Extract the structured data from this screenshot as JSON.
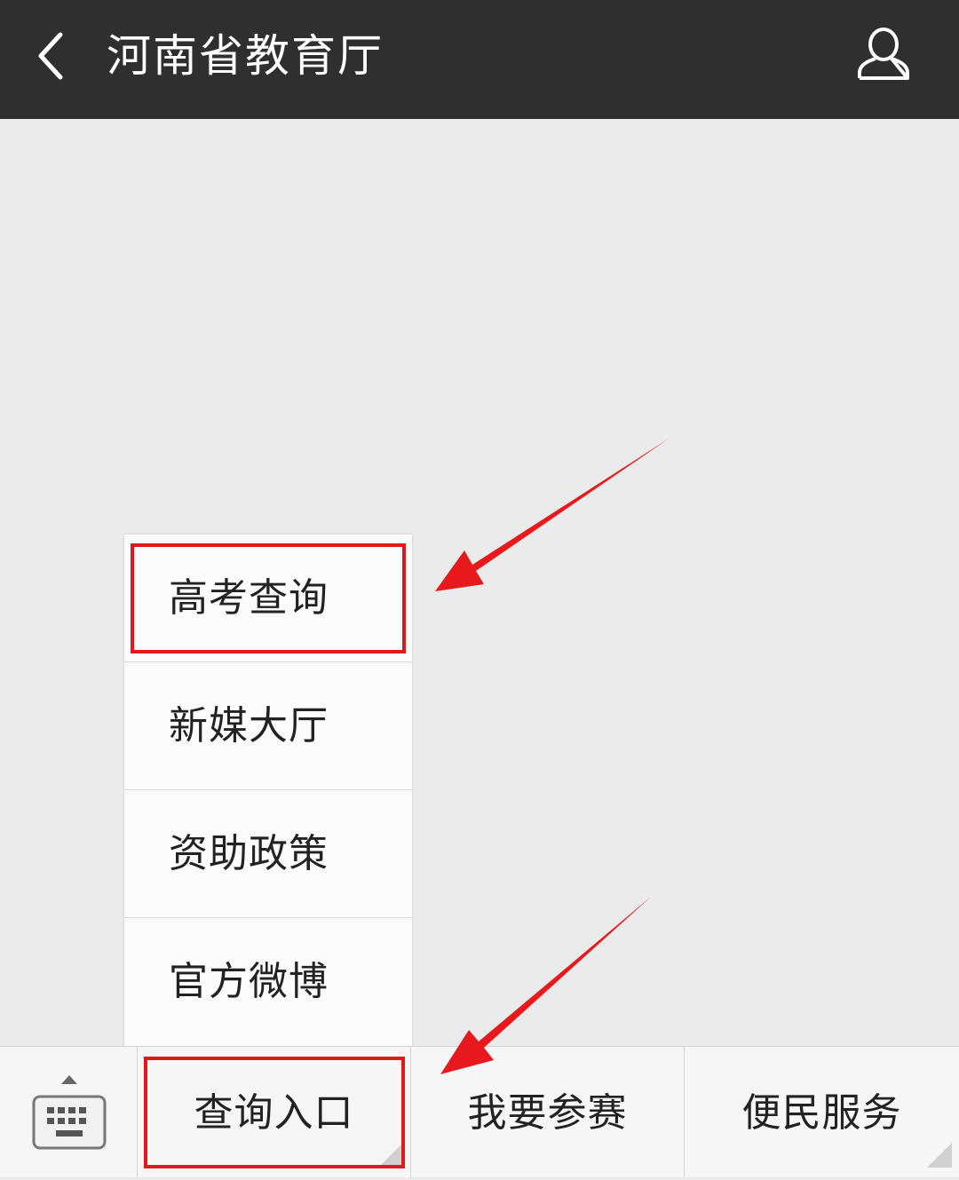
{
  "header": {
    "title": "河南省教育厅",
    "back_icon": "chevron-left-icon",
    "profile_icon": "user-profile-icon",
    "background": "#2f2f2f"
  },
  "menu_popup": {
    "items": [
      {
        "label": "高考查询",
        "highlighted": true
      },
      {
        "label": "新媒大厅",
        "highlighted": false
      },
      {
        "label": "资助政策",
        "highlighted": false
      },
      {
        "label": "官方微博",
        "highlighted": false
      }
    ]
  },
  "bottom_menu": {
    "keyboard_icon": "keyboard-toggle-icon",
    "tabs": [
      {
        "label": "查询入口",
        "highlighted": true
      },
      {
        "label": "我要参赛",
        "highlighted": false
      },
      {
        "label": "便民服务",
        "highlighted": false
      }
    ]
  },
  "annotations": {
    "highlight_color": "#e0191c",
    "arrow_color": "#e8191c"
  }
}
